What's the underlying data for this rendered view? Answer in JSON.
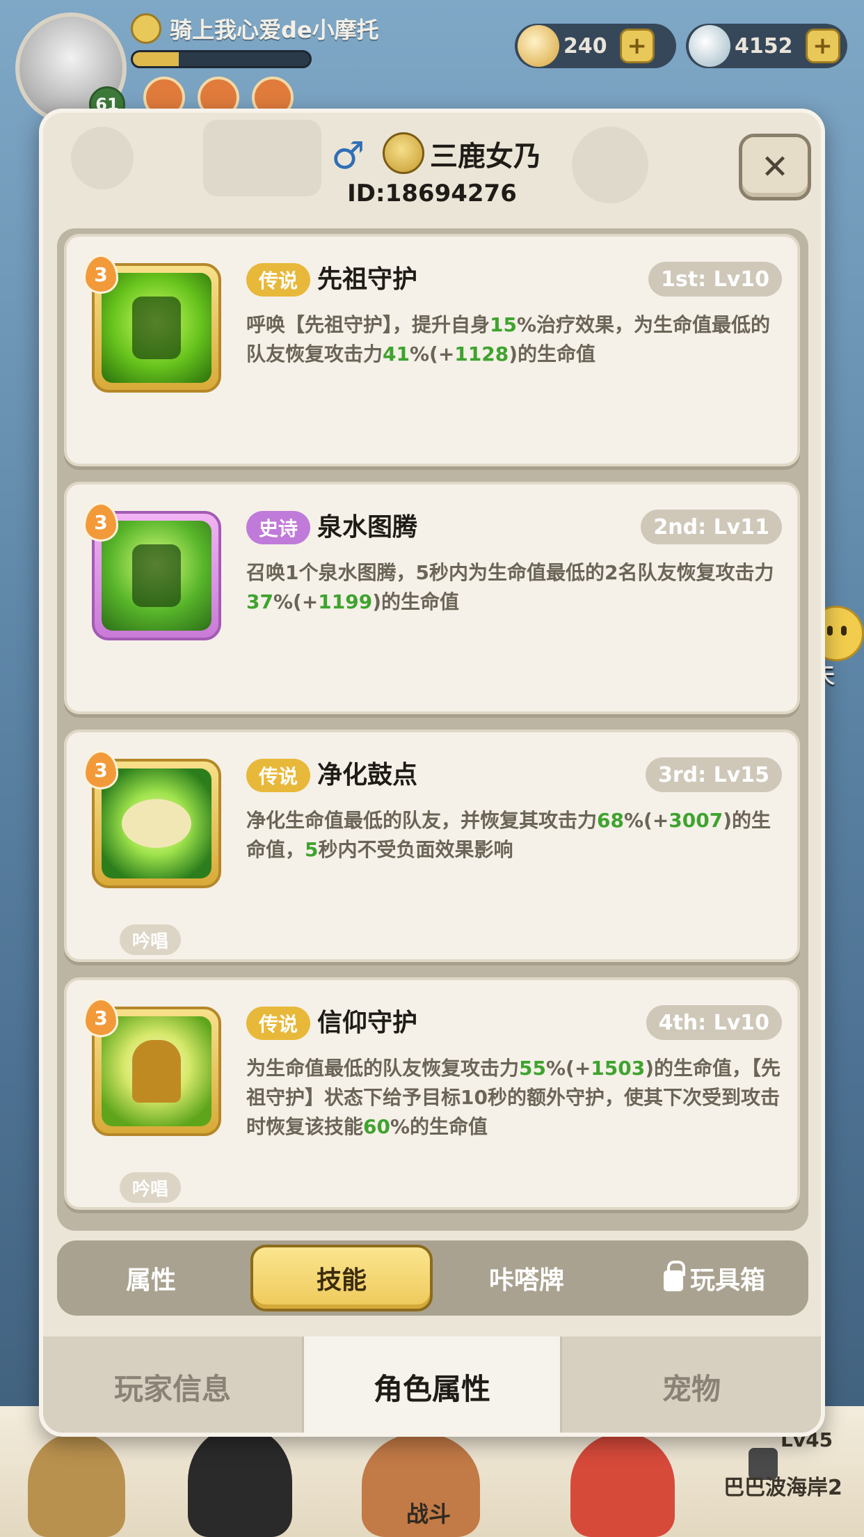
{
  "hud": {
    "player_name": "骑上我心爱de小摩托",
    "level": "61",
    "xp_fraction": 0.26,
    "gold": "240",
    "pearls": "4152"
  },
  "chat": {
    "label": "聊天"
  },
  "bottom": {
    "fight_label": "战斗",
    "level_req": "Lv45",
    "area_name": "巴巴波海岸2"
  },
  "modal": {
    "gender_symbol": "♂",
    "name": "三鹿女乃",
    "id": "ID:18694276",
    "close": "✕"
  },
  "skills": [
    {
      "level": "3",
      "rarity": "传说",
      "name": "先祖守护",
      "slot": "1st: Lv10",
      "desc_parts": [
        {
          "t": "呼唤【先祖守护】，提升自身",
          "g": false
        },
        {
          "t": "15",
          "g": true
        },
        {
          "t": "%治疗效果，为生命值最低的队友恢复攻击力",
          "g": false
        },
        {
          "t": "41",
          "g": true
        },
        {
          "t": "%(+",
          "g": false
        },
        {
          "t": "1128",
          "g": true
        },
        {
          "t": ")的生命值",
          "g": false
        }
      ],
      "tag": ""
    },
    {
      "level": "3",
      "rarity": "史诗",
      "name": "泉水图腾",
      "slot": "2nd: Lv11",
      "desc_parts": [
        {
          "t": "召唤1个泉水图腾，5秒内为生命值最低的2名队友恢复攻击力",
          "g": false
        },
        {
          "t": "37",
          "g": true
        },
        {
          "t": "%(+",
          "g": false
        },
        {
          "t": "1199",
          "g": true
        },
        {
          "t": ")的生命值",
          "g": false
        }
      ],
      "tag": ""
    },
    {
      "level": "3",
      "rarity": "传说",
      "name": "净化鼓点",
      "slot": "3rd: Lv15",
      "desc_parts": [
        {
          "t": "净化生命值最低的队友，并恢复其攻击力",
          "g": false
        },
        {
          "t": "68",
          "g": true
        },
        {
          "t": "%(+",
          "g": false
        },
        {
          "t": "3007",
          "g": true
        },
        {
          "t": ")的生命值，",
          "g": false
        },
        {
          "t": "5",
          "g": true
        },
        {
          "t": "秒内不受负面效果影响",
          "g": false
        }
      ],
      "tag": "吟唱"
    },
    {
      "level": "3",
      "rarity": "传说",
      "name": "信仰守护",
      "slot": "4th: Lv10",
      "desc_parts": [
        {
          "t": "为生命值最低的队友恢复攻击力",
          "g": false
        },
        {
          "t": "55",
          "g": true
        },
        {
          "t": "%(+",
          "g": false
        },
        {
          "t": "1503",
          "g": true
        },
        {
          "t": ")的生命值，【先祖守护】状态下给予目标10秒的额外守护，使其下次受到攻击时恢复该技能",
          "g": false
        },
        {
          "t": "60",
          "g": true
        },
        {
          "t": "%的生命值",
          "g": false
        }
      ],
      "tag": "吟唱"
    }
  ],
  "sub_tabs": [
    "属性",
    "技能",
    "咔嗒牌",
    "玩具箱"
  ],
  "main_tabs": [
    "玩家信息",
    "角色属性",
    "宠物"
  ]
}
